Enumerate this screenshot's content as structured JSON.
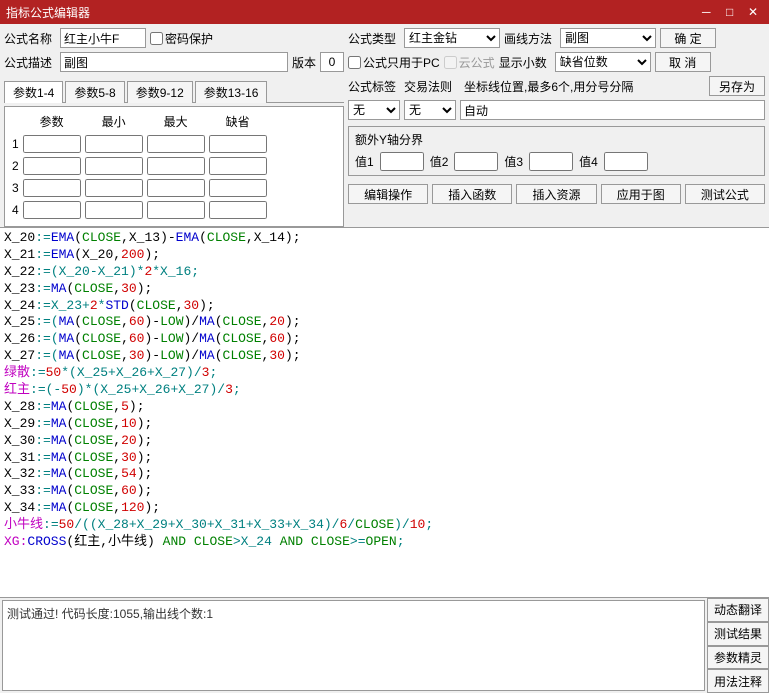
{
  "title": "指标公式编辑器",
  "labels": {
    "name": "公式名称",
    "desc": "公式描述",
    "pwd": "密码保护",
    "ver": "版本",
    "type": "公式类型",
    "drawmethod": "画线方法",
    "pconly": "公式只用于PC",
    "cloud": "云公式",
    "showdec": "显示小数",
    "tag": "公式标签",
    "rule": "交易法则",
    "coord": "坐标线位置,最多6个,用分号分隔",
    "extray": "额外Y轴分界",
    "v1": "值1",
    "v2": "值2",
    "v3": "值3",
    "v4": "值4"
  },
  "values": {
    "name": "红主小牛F",
    "desc": "副图",
    "ver": "0",
    "type": "红主金钻",
    "draw": "副图",
    "showdec": "缺省位数",
    "tag": "无",
    "rule": "无",
    "coord": "自动"
  },
  "buttons": {
    "ok": "确 定",
    "cancel": "取 消",
    "saveas": "另存为",
    "editop": "编辑操作",
    "insfn": "插入函数",
    "insres": "插入资源",
    "applychart": "应用于图",
    "test": "测试公式",
    "dyntrans": "动态翻译",
    "testres": "测试结果",
    "paramwiz": "参数精灵",
    "usage": "用法注释"
  },
  "tabs": [
    "参数1-4",
    "参数5-8",
    "参数9-12",
    "参数13-16"
  ],
  "paramhdr": [
    "参数",
    "最小",
    "最大",
    "缺省"
  ],
  "status": "测试通过! 代码长度:1055,输出线个数:1",
  "code_lines": [
    [
      [
        "X_20",
        0
      ],
      [
        ":=",
        3
      ],
      [
        "EMA",
        1
      ],
      [
        "(",
        0
      ],
      [
        "CLOSE",
        2
      ],
      [
        ",X_13)-",
        0
      ],
      [
        "EMA",
        1
      ],
      [
        "(",
        0
      ],
      [
        "CLOSE",
        2
      ],
      [
        ",X_14);",
        0
      ]
    ],
    [
      [
        "X_21",
        0
      ],
      [
        ":=",
        3
      ],
      [
        "EMA",
        1
      ],
      [
        "(X_20,",
        0
      ],
      [
        "200",
        4
      ],
      [
        ");",
        0
      ]
    ],
    [
      [
        "X_22",
        0
      ],
      [
        ":=(X_20-X_21)*",
        3
      ],
      [
        "2",
        4
      ],
      [
        "*X_16;",
        3
      ]
    ],
    [
      [
        "X_23",
        0
      ],
      [
        ":=",
        3
      ],
      [
        "MA",
        1
      ],
      [
        "(",
        0
      ],
      [
        "CLOSE",
        2
      ],
      [
        ",",
        0
      ],
      [
        "30",
        4
      ],
      [
        ");",
        0
      ]
    ],
    [
      [
        "X_24",
        0
      ],
      [
        ":=X_23+",
        3
      ],
      [
        "2",
        4
      ],
      [
        "*",
        3
      ],
      [
        "STD",
        1
      ],
      [
        "(",
        0
      ],
      [
        "CLOSE",
        2
      ],
      [
        ",",
        0
      ],
      [
        "30",
        4
      ],
      [
        ");",
        0
      ]
    ],
    [
      [
        "X_25",
        0
      ],
      [
        ":=(",
        3
      ],
      [
        "MA",
        1
      ],
      [
        "(",
        0
      ],
      [
        "CLOSE",
        2
      ],
      [
        ",",
        0
      ],
      [
        "60",
        4
      ],
      [
        ")-",
        0
      ],
      [
        "LOW",
        2
      ],
      [
        ")/",
        0
      ],
      [
        "MA",
        1
      ],
      [
        "(",
        0
      ],
      [
        "CLOSE",
        2
      ],
      [
        ",",
        0
      ],
      [
        "20",
        4
      ],
      [
        ");",
        0
      ]
    ],
    [
      [
        "X_26",
        0
      ],
      [
        ":=(",
        3
      ],
      [
        "MA",
        1
      ],
      [
        "(",
        0
      ],
      [
        "CLOSE",
        2
      ],
      [
        ",",
        0
      ],
      [
        "60",
        4
      ],
      [
        ")-",
        0
      ],
      [
        "LOW",
        2
      ],
      [
        ")/",
        0
      ],
      [
        "MA",
        1
      ],
      [
        "(",
        0
      ],
      [
        "CLOSE",
        2
      ],
      [
        ",",
        0
      ],
      [
        "60",
        4
      ],
      [
        ");",
        0
      ]
    ],
    [
      [
        "X_27",
        0
      ],
      [
        ":=(",
        3
      ],
      [
        "MA",
        1
      ],
      [
        "(",
        0
      ],
      [
        "CLOSE",
        2
      ],
      [
        ",",
        0
      ],
      [
        "30",
        4
      ],
      [
        ")-",
        0
      ],
      [
        "LOW",
        2
      ],
      [
        ")/",
        0
      ],
      [
        "MA",
        1
      ],
      [
        "(",
        0
      ],
      [
        "CLOSE",
        2
      ],
      [
        ",",
        0
      ],
      [
        "30",
        4
      ],
      [
        ");",
        0
      ]
    ],
    [
      [
        "绿散",
        5
      ],
      [
        ":=",
        3
      ],
      [
        "50",
        4
      ],
      [
        "*(X_25+X_26+X_27)/",
        3
      ],
      [
        "3",
        4
      ],
      [
        ";",
        3
      ]
    ],
    [
      [
        "红主",
        5
      ],
      [
        ":=(-",
        3
      ],
      [
        "50",
        4
      ],
      [
        ")*(X_25+X_26+X_27)/",
        3
      ],
      [
        "3",
        4
      ],
      [
        ";",
        3
      ]
    ],
    [
      [
        "X_28",
        0
      ],
      [
        ":=",
        3
      ],
      [
        "MA",
        1
      ],
      [
        "(",
        0
      ],
      [
        "CLOSE",
        2
      ],
      [
        ",",
        0
      ],
      [
        "5",
        4
      ],
      [
        ");",
        0
      ]
    ],
    [
      [
        "X_29",
        0
      ],
      [
        ":=",
        3
      ],
      [
        "MA",
        1
      ],
      [
        "(",
        0
      ],
      [
        "CLOSE",
        2
      ],
      [
        ",",
        0
      ],
      [
        "10",
        4
      ],
      [
        ");",
        0
      ]
    ],
    [
      [
        "X_30",
        0
      ],
      [
        ":=",
        3
      ],
      [
        "MA",
        1
      ],
      [
        "(",
        0
      ],
      [
        "CLOSE",
        2
      ],
      [
        ",",
        0
      ],
      [
        "20",
        4
      ],
      [
        ");",
        0
      ]
    ],
    [
      [
        "X_31",
        0
      ],
      [
        ":=",
        3
      ],
      [
        "MA",
        1
      ],
      [
        "(",
        0
      ],
      [
        "CLOSE",
        2
      ],
      [
        ",",
        0
      ],
      [
        "30",
        4
      ],
      [
        ");",
        0
      ]
    ],
    [
      [
        "X_32",
        0
      ],
      [
        ":=",
        3
      ],
      [
        "MA",
        1
      ],
      [
        "(",
        0
      ],
      [
        "CLOSE",
        2
      ],
      [
        ",",
        0
      ],
      [
        "54",
        4
      ],
      [
        ");",
        0
      ]
    ],
    [
      [
        "X_33",
        0
      ],
      [
        ":=",
        3
      ],
      [
        "MA",
        1
      ],
      [
        "(",
        0
      ],
      [
        "CLOSE",
        2
      ],
      [
        ",",
        0
      ],
      [
        "60",
        4
      ],
      [
        ");",
        0
      ]
    ],
    [
      [
        "X_34",
        0
      ],
      [
        ":=",
        3
      ],
      [
        "MA",
        1
      ],
      [
        "(",
        0
      ],
      [
        "CLOSE",
        2
      ],
      [
        ",",
        0
      ],
      [
        "120",
        4
      ],
      [
        ");",
        0
      ]
    ],
    [
      [
        "小牛线",
        5
      ],
      [
        ":=",
        3
      ],
      [
        "50",
        4
      ],
      [
        "/((X_28+X_29+X_30+X_31+X_33+X_34)/",
        3
      ],
      [
        "6",
        4
      ],
      [
        "/",
        3
      ],
      [
        "CLOSE",
        2
      ],
      [
        ")/",
        3
      ],
      [
        "10",
        4
      ],
      [
        ";",
        3
      ]
    ],
    [
      [
        "XG:",
        5
      ],
      [
        "CROSS",
        1
      ],
      [
        "(红主,小牛线) ",
        0
      ],
      [
        "AND",
        2
      ],
      [
        " ",
        0
      ],
      [
        "CLOSE",
        2
      ],
      [
        ">X_24 ",
        3
      ],
      [
        "AND",
        2
      ],
      [
        " ",
        0
      ],
      [
        "CLOSE",
        2
      ],
      [
        ">=",
        3
      ],
      [
        "OPEN",
        2
      ],
      [
        ";",
        3
      ]
    ]
  ],
  "color_map": [
    "",
    "c-blue",
    "c-green",
    "c-teal",
    "c-red",
    "c-mag"
  ]
}
